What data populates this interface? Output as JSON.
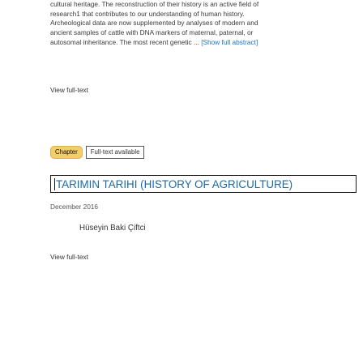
{
  "result1": {
    "abstract_lines": [
      "cultural heritage. The reconstruction of their history is an active field of",
      "research1 that contributes to our understanding of human history.",
      "Archeological data are now supplemented by analyses of modern and",
      "ancient samples of cattle with DNA markers of maternal, paternal, or",
      "autosomal inheritance. The most recent genetic ..."
    ],
    "show_abstract_label": "[Show full abstract]",
    "view_fulltext_label": "View full-text"
  },
  "result2": {
    "badge_type": "Chapter",
    "badge_availability": "Full-text available",
    "title": "TARIMIN TARIHI (HISTORY OF AGRICULTURE)",
    "date": "December 2016",
    "author": "Hüseyin Baki Çiftci",
    "view_fulltext_label": "View full-text"
  }
}
